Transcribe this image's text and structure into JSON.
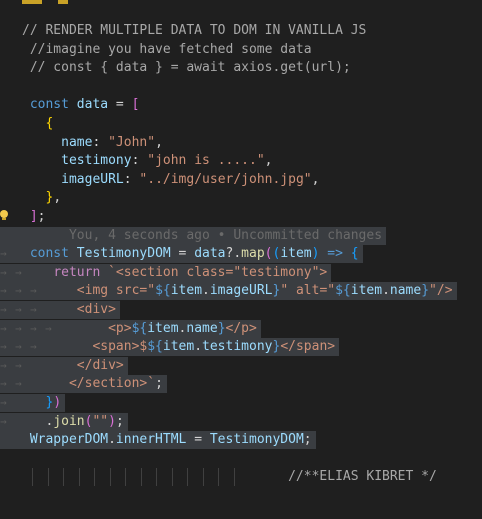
{
  "editor": {
    "colors": {
      "background": "#1f1f1f",
      "selection": "#3a3d41",
      "comment": "#a8a8a8",
      "keyword": "#569cd6",
      "control": "#c586c0",
      "variable": "#9cdcfe",
      "function": "#dcdcaa",
      "string": "#ce9178",
      "tag": "#569cd6",
      "bracket_gold": "#ffd700",
      "bracket_purple": "#da70d6",
      "bracket_blue": "#179fff",
      "punctuation": "#d4d4d4",
      "blame": "#6a6a6a"
    },
    "lines": [
      {
        "tokens": [
          {
            "t": "// RENDER MULTIPLE DATA TO DOM IN VANILLA JS",
            "c": "comment"
          }
        ]
      },
      {
        "tokens": [
          {
            "t": " //imagine you have fetched some data",
            "c": "comment"
          }
        ]
      },
      {
        "tokens": [
          {
            "t": " // const { data } = await axios.get(url);",
            "c": "comment"
          }
        ]
      },
      {
        "tokens": []
      },
      {
        "tokens": [
          {
            "t": " const",
            "c": "keyword"
          },
          {
            "t": " ",
            "c": "punctuation"
          },
          {
            "t": "data",
            "c": "variable"
          },
          {
            "t": " = ",
            "c": "punctuation"
          },
          {
            "t": "[",
            "c": "bracket_purple"
          }
        ]
      },
      {
        "tokens": [
          {
            "t": "   ",
            "c": "punctuation"
          },
          {
            "t": "{",
            "c": "bracket_gold"
          }
        ]
      },
      {
        "tokens": [
          {
            "t": "     ",
            "c": "punctuation"
          },
          {
            "t": "name",
            "c": "variable"
          },
          {
            "t": ": ",
            "c": "punctuation"
          },
          {
            "t": "\"John\"",
            "c": "string"
          },
          {
            "t": ",",
            "c": "punctuation"
          }
        ]
      },
      {
        "tokens": [
          {
            "t": "     ",
            "c": "punctuation"
          },
          {
            "t": "testimony",
            "c": "variable"
          },
          {
            "t": ": ",
            "c": "punctuation"
          },
          {
            "t": "\"john is .....\"",
            "c": "string"
          },
          {
            "t": ",",
            "c": "punctuation"
          }
        ]
      },
      {
        "tokens": [
          {
            "t": "     ",
            "c": "punctuation"
          },
          {
            "t": "imageURL",
            "c": "variable"
          },
          {
            "t": ": ",
            "c": "punctuation"
          },
          {
            "t": "\"../img/user/john.jpg\"",
            "c": "string"
          },
          {
            "t": ",",
            "c": "punctuation"
          }
        ]
      },
      {
        "tokens": [
          {
            "t": "   ",
            "c": "punctuation"
          },
          {
            "t": "}",
            "c": "bracket_gold"
          },
          {
            "t": ",",
            "c": "punctuation"
          }
        ]
      },
      {
        "bulb": true,
        "tokens": [
          {
            "t": " ",
            "c": "punctuation"
          },
          {
            "t": "]",
            "c": "bracket_purple"
          },
          {
            "t": ";",
            "c": "punctuation"
          }
        ]
      },
      {
        "sel": true,
        "tokens": [
          {
            "t": "      You, 4 seconds ago • Uncommitted changes",
            "c": "blame"
          }
        ]
      },
      {
        "sel": true,
        "arrows": [
          1
        ],
        "tokens": [
          {
            "t": " const",
            "c": "keyword"
          },
          {
            "t": " ",
            "c": "punctuation"
          },
          {
            "t": "TestimonyDOM",
            "c": "variable"
          },
          {
            "t": " = ",
            "c": "punctuation"
          },
          {
            "t": "data",
            "c": "variable"
          },
          {
            "t": "?.",
            "c": "punctuation"
          },
          {
            "t": "map",
            "c": "function"
          },
          {
            "t": "(",
            "c": "bracket_purple"
          },
          {
            "t": "(",
            "c": "bracket_blue"
          },
          {
            "t": "item",
            "c": "variable"
          },
          {
            "t": ")",
            "c": "bracket_blue"
          },
          {
            "t": " => ",
            "c": "keyword"
          },
          {
            "t": "{",
            "c": "bracket_blue"
          }
        ]
      },
      {
        "sel": true,
        "arrows": [
          1,
          2
        ],
        "tokens": [
          {
            "t": "    ",
            "c": "punctuation"
          },
          {
            "t": "return",
            "c": "control"
          },
          {
            "t": " `<section class=\"testimony\">",
            "c": "string"
          }
        ]
      },
      {
        "sel": true,
        "arrows": [
          1,
          2,
          3
        ],
        "tokens": [
          {
            "t": "       <img src=\"",
            "c": "string"
          },
          {
            "t": "${",
            "c": "keyword"
          },
          {
            "t": "item",
            "c": "variable"
          },
          {
            "t": ".",
            "c": "punctuation"
          },
          {
            "t": "imageURL",
            "c": "variable"
          },
          {
            "t": "}",
            "c": "keyword"
          },
          {
            "t": "\" alt=\"",
            "c": "string"
          },
          {
            "t": "${",
            "c": "keyword"
          },
          {
            "t": "item",
            "c": "variable"
          },
          {
            "t": ".",
            "c": "punctuation"
          },
          {
            "t": "name",
            "c": "variable"
          },
          {
            "t": "}",
            "c": "keyword"
          },
          {
            "t": "\"/>",
            "c": "string"
          }
        ]
      },
      {
        "sel": true,
        "arrows": [
          1,
          2,
          3
        ],
        "tokens": [
          {
            "t": "       <div>",
            "c": "string"
          }
        ]
      },
      {
        "sel": true,
        "arrows": [
          1,
          2,
          3,
          4
        ],
        "tokens": [
          {
            "t": "           <p>",
            "c": "string"
          },
          {
            "t": "${",
            "c": "keyword"
          },
          {
            "t": "item",
            "c": "variable"
          },
          {
            "t": ".",
            "c": "punctuation"
          },
          {
            "t": "name",
            "c": "variable"
          },
          {
            "t": "}",
            "c": "keyword"
          },
          {
            "t": "</p>",
            "c": "string"
          }
        ]
      },
      {
        "sel": true,
        "arrows": [
          1,
          2,
          3
        ],
        "tokens": [
          {
            "t": "         <span>$",
            "c": "string"
          },
          {
            "t": "${",
            "c": "keyword"
          },
          {
            "t": "item",
            "c": "variable"
          },
          {
            "t": ".",
            "c": "punctuation"
          },
          {
            "t": "testimony",
            "c": "variable"
          },
          {
            "t": "}",
            "c": "keyword"
          },
          {
            "t": "</span>",
            "c": "string"
          }
        ]
      },
      {
        "sel": true,
        "arrows": [
          1,
          2
        ],
        "tokens": [
          {
            "t": "       </div>",
            "c": "string"
          }
        ]
      },
      {
        "sel": true,
        "arrows": [
          1,
          2
        ],
        "tokens": [
          {
            "t": "      </section>`",
            "c": "string"
          },
          {
            "t": ";",
            "c": "punctuation"
          }
        ]
      },
      {
        "sel": true,
        "arrows": [
          1
        ],
        "tokens": [
          {
            "t": "   ",
            "c": "punctuation"
          },
          {
            "t": "}",
            "c": "bracket_blue"
          },
          {
            "t": ")",
            "c": "bracket_purple"
          }
        ]
      },
      {
        "sel": true,
        "arrows": [
          1
        ],
        "tokens": [
          {
            "t": "   .",
            "c": "punctuation"
          },
          {
            "t": "join",
            "c": "function"
          },
          {
            "t": "(",
            "c": "bracket_purple"
          },
          {
            "t": "\"\"",
            "c": "string"
          },
          {
            "t": ")",
            "c": "bracket_purple"
          },
          {
            "t": ";",
            "c": "punctuation"
          }
        ]
      },
      {
        "sel": true,
        "tokens": [
          {
            "t": " WrapperDOM",
            "c": "variable"
          },
          {
            "t": ".",
            "c": "punctuation"
          },
          {
            "t": "innerHTML",
            "c": "variable"
          },
          {
            "t": " = ",
            "c": "punctuation"
          },
          {
            "t": "TestimonyDOM",
            "c": "variable"
          },
          {
            "t": ";",
            "c": "punctuation"
          }
        ]
      },
      {
        "tokens": []
      },
      {
        "guides": 14,
        "tokens": [
          {
            "t": "                                  //**ELIAS KIBRET */",
            "c": "comment"
          }
        ]
      }
    ]
  }
}
